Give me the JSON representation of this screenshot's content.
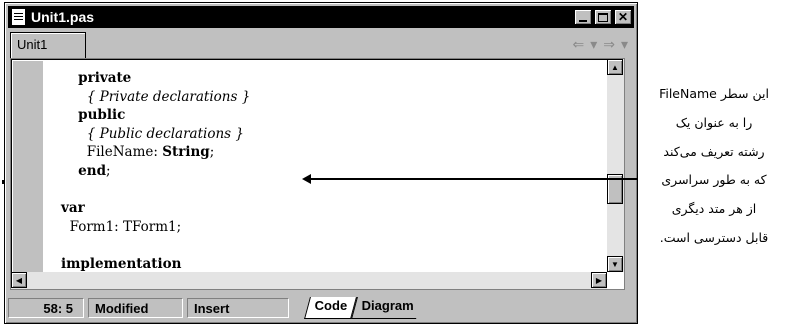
{
  "window": {
    "title": "Unit1.pas",
    "title_icon": "document-icon",
    "controls": [
      "minimize-icon",
      "maximize-icon",
      "close-icon"
    ]
  },
  "tabs": {
    "active_file": "Unit1",
    "nav_icons": [
      "back-arrow-icon",
      "forward-arrow-icon"
    ]
  },
  "code": {
    "lines": [
      [
        {
          "t": "    ",
          "s": ""
        },
        {
          "t": "private",
          "s": "b"
        }
      ],
      [
        {
          "t": "      ",
          "s": ""
        },
        {
          "t": "{ Private declarations }",
          "s": "i"
        }
      ],
      [
        {
          "t": "    ",
          "s": ""
        },
        {
          "t": "public",
          "s": "b"
        }
      ],
      [
        {
          "t": "      ",
          "s": ""
        },
        {
          "t": "{ Public declarations }",
          "s": "i"
        }
      ],
      [
        {
          "t": "      FileName: ",
          "s": ""
        },
        {
          "t": "String",
          "s": "b"
        },
        {
          "t": ";",
          "s": ""
        }
      ],
      [
        {
          "t": "    ",
          "s": ""
        },
        {
          "t": "end",
          "s": "b"
        },
        {
          "t": ";",
          "s": ""
        }
      ],
      [
        {
          "t": "",
          "s": ""
        }
      ],
      [
        {
          "t": "var",
          "s": "b"
        }
      ],
      [
        {
          "t": "  Form1: TForm1;",
          "s": ""
        }
      ],
      [
        {
          "t": "",
          "s": ""
        }
      ],
      [
        {
          "t": "implementation",
          "s": "b"
        }
      ]
    ]
  },
  "status": {
    "position": "58:  5",
    "modified": "Modified",
    "insert_mode": "Insert",
    "tabs": [
      "Code",
      "Diagram"
    ]
  },
  "annotation": {
    "lines": [
      "این سطر FileName",
      "را به عنوان یک",
      "رشته تعریف می‌کند",
      "که به طور سراسری",
      "از هر متد دیگری",
      "قابل دسترسی است."
    ]
  },
  "colors": {
    "titlebar": "#000000",
    "chrome": "#c0c0c0",
    "editor_bg": "#ffffff"
  }
}
